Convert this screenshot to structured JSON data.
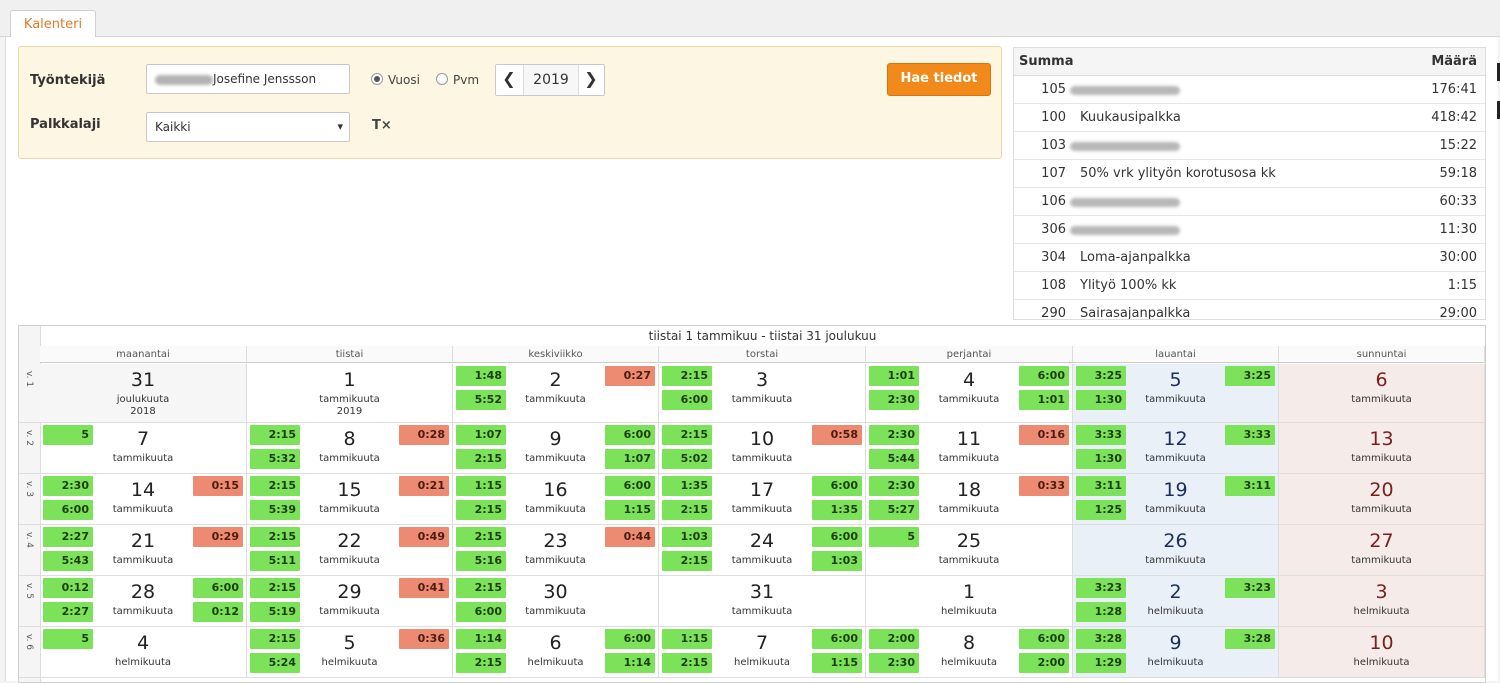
{
  "tab": {
    "label": "Kalenteri"
  },
  "filters": {
    "employee_label": "Työntekijä",
    "employee_value": "Josefine Jenssson",
    "wage_label": "Palkkalaji",
    "wage_value": "Kaikki",
    "radio_year": "Vuosi",
    "radio_date": "Pvm",
    "year": "2019",
    "prev": "❮",
    "next": "❯",
    "search_button": "Hae tiedot",
    "clear_icon": "T×",
    "select_arrow": "▾"
  },
  "summary": {
    "col_sum": "Summa",
    "col_amount": "Määrä",
    "rows": [
      {
        "code": "105",
        "name": "",
        "amount": "176:41",
        "blurred": true
      },
      {
        "code": "100",
        "name": "Kuukausipalkka",
        "amount": "418:42",
        "blurred": false
      },
      {
        "code": "103",
        "name": "",
        "amount": "15:22",
        "blurred": true
      },
      {
        "code": "107",
        "name": "50% vrk ylityön korotusosa kk",
        "amount": "59:18",
        "blurred": false
      },
      {
        "code": "106",
        "name": "",
        "amount": "60:33",
        "blurred": true
      },
      {
        "code": "306",
        "name": "",
        "amount": "11:30",
        "blurred": true
      },
      {
        "code": "304",
        "name": "Loma-ajanpalkka",
        "amount": "30:00",
        "blurred": false
      },
      {
        "code": "108",
        "name": "Ylityö 100% kk",
        "amount": "1:15",
        "blurred": false
      },
      {
        "code": "290",
        "name": "Sairasajanpalkka",
        "amount": "29:00",
        "blurred": false
      }
    ]
  },
  "calendar": {
    "range_title": "tiistai 1 tammikuu - tiistai 31 joulukuu",
    "days": [
      "maanantai",
      "tiistai",
      "keskiviikko",
      "torstai",
      "perjantai",
      "lauantai",
      "sunnuntai"
    ],
    "weeks": [
      {
        "label": "v. 1",
        "cells": [
          {
            "day": "31",
            "month": "joulukuuta",
            "year": "2018",
            "type": "prev",
            "badges": []
          },
          {
            "day": "1",
            "month": "tammikuuta",
            "year": "2019",
            "type": "",
            "badges": []
          },
          {
            "day": "2",
            "month": "tammikuuta",
            "type": "",
            "badges": [
              {
                "pos": "tl",
                "v": "1:48",
                "c": "g"
              },
              {
                "pos": "bl",
                "v": "5:52",
                "c": "g"
              },
              {
                "pos": "tr",
                "v": "0:27",
                "c": "r"
              }
            ]
          },
          {
            "day": "3",
            "month": "tammikuuta",
            "type": "",
            "badges": [
              {
                "pos": "tl",
                "v": "2:15",
                "c": "g"
              },
              {
                "pos": "bl",
                "v": "6:00",
                "c": "g"
              }
            ]
          },
          {
            "day": "4",
            "month": "tammikuuta",
            "type": "",
            "badges": [
              {
                "pos": "tl",
                "v": "1:01",
                "c": "g"
              },
              {
                "pos": "bl",
                "v": "2:30",
                "c": "g"
              },
              {
                "pos": "tr",
                "v": "6:00",
                "c": "g"
              },
              {
                "pos": "br",
                "v": "1:01",
                "c": "g"
              }
            ]
          },
          {
            "day": "5",
            "month": "tammikuuta",
            "type": "sat",
            "badges": [
              {
                "pos": "tl",
                "v": "3:25",
                "c": "g"
              },
              {
                "pos": "bl",
                "v": "1:30",
                "c": "g"
              },
              {
                "pos": "tr",
                "v": "3:25",
                "c": "g"
              }
            ]
          },
          {
            "day": "6",
            "month": "tammikuuta",
            "type": "sun",
            "badges": []
          }
        ]
      },
      {
        "label": "v. 2",
        "cells": [
          {
            "day": "7",
            "month": "tammikuuta",
            "type": "",
            "badges": [
              {
                "pos": "tl",
                "v": "5",
                "c": "g"
              }
            ]
          },
          {
            "day": "8",
            "month": "tammikuuta",
            "type": "",
            "badges": [
              {
                "pos": "tl",
                "v": "2:15",
                "c": "g"
              },
              {
                "pos": "bl",
                "v": "5:32",
                "c": "g"
              },
              {
                "pos": "tr",
                "v": "0:28",
                "c": "r"
              }
            ]
          },
          {
            "day": "9",
            "month": "tammikuuta",
            "type": "",
            "badges": [
              {
                "pos": "tl",
                "v": "1:07",
                "c": "g"
              },
              {
                "pos": "bl",
                "v": "2:15",
                "c": "g"
              },
              {
                "pos": "tr",
                "v": "6:00",
                "c": "g"
              },
              {
                "pos": "br",
                "v": "1:07",
                "c": "g"
              }
            ]
          },
          {
            "day": "10",
            "month": "tammikuuta",
            "type": "",
            "badges": [
              {
                "pos": "tl",
                "v": "2:15",
                "c": "g"
              },
              {
                "pos": "bl",
                "v": "5:02",
                "c": "g"
              },
              {
                "pos": "tr",
                "v": "0:58",
                "c": "r"
              }
            ]
          },
          {
            "day": "11",
            "month": "tammikuuta",
            "type": "",
            "badges": [
              {
                "pos": "tl",
                "v": "2:30",
                "c": "g"
              },
              {
                "pos": "bl",
                "v": "5:44",
                "c": "g"
              },
              {
                "pos": "tr",
                "v": "0:16",
                "c": "r"
              }
            ]
          },
          {
            "day": "12",
            "month": "tammikuuta",
            "type": "sat",
            "badges": [
              {
                "pos": "tl",
                "v": "3:33",
                "c": "g"
              },
              {
                "pos": "bl",
                "v": "1:30",
                "c": "g"
              },
              {
                "pos": "tr",
                "v": "3:33",
                "c": "g"
              }
            ]
          },
          {
            "day": "13",
            "month": "tammikuuta",
            "type": "sun",
            "badges": []
          }
        ]
      },
      {
        "label": "v. 3",
        "cells": [
          {
            "day": "14",
            "month": "tammikuuta",
            "type": "",
            "badges": [
              {
                "pos": "tl",
                "v": "2:30",
                "c": "g"
              },
              {
                "pos": "bl",
                "v": "6:00",
                "c": "g"
              },
              {
                "pos": "tr",
                "v": "0:15",
                "c": "r"
              }
            ]
          },
          {
            "day": "15",
            "month": "tammikuuta",
            "type": "",
            "badges": [
              {
                "pos": "tl",
                "v": "2:15",
                "c": "g"
              },
              {
                "pos": "bl",
                "v": "5:39",
                "c": "g"
              },
              {
                "pos": "tr",
                "v": "0:21",
                "c": "r"
              }
            ]
          },
          {
            "day": "16",
            "month": "tammikuuta",
            "type": "",
            "badges": [
              {
                "pos": "tl",
                "v": "1:15",
                "c": "g"
              },
              {
                "pos": "bl",
                "v": "2:15",
                "c": "g"
              },
              {
                "pos": "tr",
                "v": "6:00",
                "c": "g"
              },
              {
                "pos": "br",
                "v": "1:15",
                "c": "g"
              }
            ]
          },
          {
            "day": "17",
            "month": "tammikuuta",
            "type": "",
            "badges": [
              {
                "pos": "tl",
                "v": "1:35",
                "c": "g"
              },
              {
                "pos": "bl",
                "v": "2:15",
                "c": "g"
              },
              {
                "pos": "tr",
                "v": "6:00",
                "c": "g"
              },
              {
                "pos": "br",
                "v": "1:35",
                "c": "g"
              }
            ]
          },
          {
            "day": "18",
            "month": "tammikuuta",
            "type": "",
            "badges": [
              {
                "pos": "tl",
                "v": "2:30",
                "c": "g"
              },
              {
                "pos": "bl",
                "v": "5:27",
                "c": "g"
              },
              {
                "pos": "tr",
                "v": "0:33",
                "c": "r"
              }
            ]
          },
          {
            "day": "19",
            "month": "tammikuuta",
            "type": "sat",
            "badges": [
              {
                "pos": "tl",
                "v": "3:11",
                "c": "g"
              },
              {
                "pos": "bl",
                "v": "1:25",
                "c": "g"
              },
              {
                "pos": "tr",
                "v": "3:11",
                "c": "g"
              }
            ]
          },
          {
            "day": "20",
            "month": "tammikuuta",
            "type": "sun",
            "badges": []
          }
        ]
      },
      {
        "label": "v. 4",
        "cells": [
          {
            "day": "21",
            "month": "tammikuuta",
            "type": "",
            "badges": [
              {
                "pos": "tl",
                "v": "2:27",
                "c": "g"
              },
              {
                "pos": "bl",
                "v": "5:43",
                "c": "g"
              },
              {
                "pos": "tr",
                "v": "0:29",
                "c": "r"
              }
            ]
          },
          {
            "day": "22",
            "month": "tammikuuta",
            "type": "",
            "badges": [
              {
                "pos": "tl",
                "v": "2:15",
                "c": "g"
              },
              {
                "pos": "bl",
                "v": "5:11",
                "c": "g"
              },
              {
                "pos": "tr",
                "v": "0:49",
                "c": "r"
              }
            ]
          },
          {
            "day": "23",
            "month": "tammikuuta",
            "type": "",
            "badges": [
              {
                "pos": "tl",
                "v": "2:15",
                "c": "g"
              },
              {
                "pos": "bl",
                "v": "5:16",
                "c": "g"
              },
              {
                "pos": "tr",
                "v": "0:44",
                "c": "r"
              }
            ]
          },
          {
            "day": "24",
            "month": "tammikuuta",
            "type": "",
            "badges": [
              {
                "pos": "tl",
                "v": "1:03",
                "c": "g"
              },
              {
                "pos": "bl",
                "v": "2:15",
                "c": "g"
              },
              {
                "pos": "tr",
                "v": "6:00",
                "c": "g"
              },
              {
                "pos": "br",
                "v": "1:03",
                "c": "g"
              }
            ]
          },
          {
            "day": "25",
            "month": "tammikuuta",
            "type": "",
            "badges": [
              {
                "pos": "tl",
                "v": "5",
                "c": "g"
              }
            ]
          },
          {
            "day": "26",
            "month": "tammikuuta",
            "type": "sat",
            "badges": []
          },
          {
            "day": "27",
            "month": "tammikuuta",
            "type": "sun",
            "badges": []
          }
        ]
      },
      {
        "label": "v. 5",
        "cells": [
          {
            "day": "28",
            "month": "tammikuuta",
            "type": "",
            "badges": [
              {
                "pos": "tl",
                "v": "0:12",
                "c": "g"
              },
              {
                "pos": "bl",
                "v": "2:27",
                "c": "g"
              },
              {
                "pos": "tr",
                "v": "6:00",
                "c": "g"
              },
              {
                "pos": "br",
                "v": "0:12",
                "c": "g"
              }
            ]
          },
          {
            "day": "29",
            "month": "tammikuuta",
            "type": "",
            "badges": [
              {
                "pos": "tl",
                "v": "2:15",
                "c": "g"
              },
              {
                "pos": "bl",
                "v": "5:19",
                "c": "g"
              },
              {
                "pos": "tr",
                "v": "0:41",
                "c": "r"
              }
            ]
          },
          {
            "day": "30",
            "month": "tammikuuta",
            "type": "",
            "badges": [
              {
                "pos": "tl",
                "v": "2:15",
                "c": "g"
              },
              {
                "pos": "bl",
                "v": "6:00",
                "c": "g"
              }
            ]
          },
          {
            "day": "31",
            "month": "tammikuuta",
            "type": "",
            "badges": []
          },
          {
            "day": "1",
            "month": "helmikuuta",
            "type": "",
            "badges": []
          },
          {
            "day": "2",
            "month": "helmikuuta",
            "type": "sat",
            "badges": [
              {
                "pos": "tl",
                "v": "3:23",
                "c": "g"
              },
              {
                "pos": "bl",
                "v": "1:28",
                "c": "g"
              },
              {
                "pos": "tr",
                "v": "3:23",
                "c": "g"
              }
            ]
          },
          {
            "day": "3",
            "month": "helmikuuta",
            "type": "sun",
            "badges": []
          }
        ]
      },
      {
        "label": "v. 6",
        "cells": [
          {
            "day": "4",
            "month": "helmikuuta",
            "type": "",
            "badges": [
              {
                "pos": "tl",
                "v": "5",
                "c": "g"
              }
            ]
          },
          {
            "day": "5",
            "month": "helmikuuta",
            "type": "",
            "badges": [
              {
                "pos": "tl",
                "v": "2:15",
                "c": "g"
              },
              {
                "pos": "bl",
                "v": "5:24",
                "c": "g"
              },
              {
                "pos": "tr",
                "v": "0:36",
                "c": "r"
              }
            ]
          },
          {
            "day": "6",
            "month": "helmikuuta",
            "type": "",
            "badges": [
              {
                "pos": "tl",
                "v": "1:14",
                "c": "g"
              },
              {
                "pos": "bl",
                "v": "2:15",
                "c": "g"
              },
              {
                "pos": "tr",
                "v": "6:00",
                "c": "g"
              },
              {
                "pos": "br",
                "v": "1:14",
                "c": "g"
              }
            ]
          },
          {
            "day": "7",
            "month": "helmikuuta",
            "type": "",
            "badges": [
              {
                "pos": "tl",
                "v": "1:15",
                "c": "g"
              },
              {
                "pos": "bl",
                "v": "2:15",
                "c": "g"
              },
              {
                "pos": "tr",
                "v": "6:00",
                "c": "g"
              },
              {
                "pos": "br",
                "v": "1:15",
                "c": "g"
              }
            ]
          },
          {
            "day": "8",
            "month": "helmikuuta",
            "type": "",
            "badges": [
              {
                "pos": "tl",
                "v": "2:00",
                "c": "g"
              },
              {
                "pos": "bl",
                "v": "2:30",
                "c": "g"
              },
              {
                "pos": "tr",
                "v": "6:00",
                "c": "g"
              },
              {
                "pos": "br",
                "v": "2:00",
                "c": "g"
              }
            ]
          },
          {
            "day": "9",
            "month": "helmikuuta",
            "type": "sat",
            "badges": [
              {
                "pos": "tl",
                "v": "3:28",
                "c": "g"
              },
              {
                "pos": "bl",
                "v": "1:29",
                "c": "g"
              },
              {
                "pos": "tr",
                "v": "3:28",
                "c": "g"
              }
            ]
          },
          {
            "day": "10",
            "month": "helmikuuta",
            "type": "sun",
            "badges": []
          }
        ]
      }
    ]
  }
}
